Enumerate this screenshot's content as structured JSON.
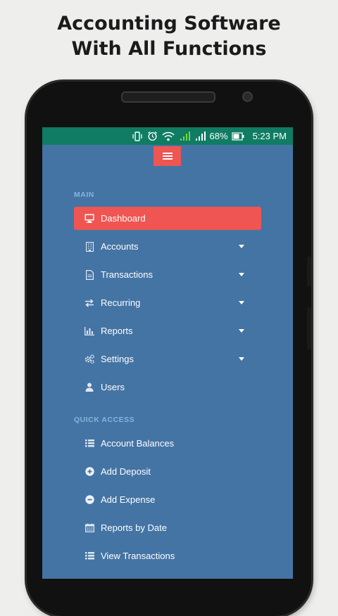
{
  "headline": {
    "line1": "Accounting Software",
    "line2": "With All Functions"
  },
  "status_bar": {
    "battery": "68%",
    "time": "5:23 PM"
  },
  "menu": {
    "main_heading": "MAIN",
    "main_items": [
      {
        "label": "Dashboard",
        "icon": "monitor-icon",
        "active": true,
        "dropdown": false
      },
      {
        "label": "Accounts",
        "icon": "building-icon",
        "dropdown": true
      },
      {
        "label": "Transactions",
        "icon": "document-icon",
        "dropdown": true
      },
      {
        "label": "Recurring",
        "icon": "exchange-icon",
        "dropdown": true
      },
      {
        "label": "Reports",
        "icon": "bar-chart-icon",
        "dropdown": true
      },
      {
        "label": "Settings",
        "icon": "cogs-icon",
        "dropdown": true
      },
      {
        "label": "Users",
        "icon": "user-icon",
        "dropdown": false
      }
    ],
    "quick_heading": "QUICK ACCESS",
    "quick_items": [
      {
        "label": "Account Balances",
        "icon": "list-icon"
      },
      {
        "label": "Add Deposit",
        "icon": "plus-circle-icon"
      },
      {
        "label": "Add Expense",
        "icon": "minus-circle-icon"
      },
      {
        "label": "Reports by Date",
        "icon": "calendar-icon"
      },
      {
        "label": "View Transactions",
        "icon": "list-icon"
      }
    ]
  },
  "colors": {
    "sidebar_bg": "#4474a4",
    "active_bg": "#ef5552",
    "status_bar_bg": "#0f7c63",
    "section_heading": "#86b4dd"
  }
}
